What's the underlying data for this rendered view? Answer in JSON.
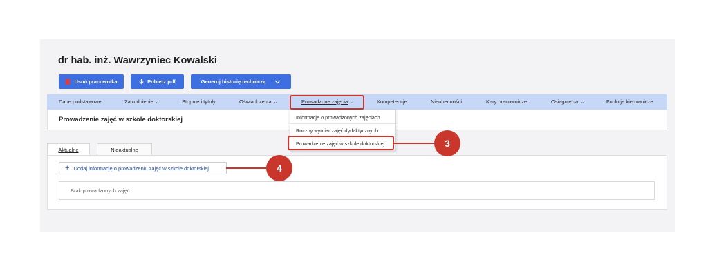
{
  "header": {
    "title": "dr hab. inż. Wawrzyniec Kowalski"
  },
  "toolbar": {
    "delete_label": "Usuń pracownika",
    "download_label": "Pobierz pdf",
    "history_label": "Generuj historię techniczą"
  },
  "nav": {
    "items": [
      {
        "label": "Dane podstawowe",
        "dropdown": false
      },
      {
        "label": "Zatrudnienie",
        "dropdown": true
      },
      {
        "label": "Stopnie i tytuły",
        "dropdown": false
      },
      {
        "label": "Oświadczenia",
        "dropdown": true
      },
      {
        "label": "Prowadzone zajęcia",
        "dropdown": true,
        "active": true
      },
      {
        "label": "Kompetencje",
        "dropdown": false
      },
      {
        "label": "Nieobecności",
        "dropdown": false
      },
      {
        "label": "Kary pracownicze",
        "dropdown": false
      },
      {
        "label": "Osiągnięcia",
        "dropdown": true
      },
      {
        "label": "Funkcje kierownicze",
        "dropdown": false
      }
    ]
  },
  "dropdown": {
    "items": [
      "Informacje o prowadzonych zajęciach",
      "Roczny wymiar zajęć dydaktycznych",
      "Prowadzenie zajęć w szkole doktorskiej"
    ]
  },
  "section": {
    "heading": "Prowadzenie zajęć w szkole doktorskiej"
  },
  "tabs": [
    {
      "label": "Aktualne",
      "active": true
    },
    {
      "label": "Nieaktualne",
      "active": false
    }
  ],
  "content": {
    "add_label": "Dodaj informację o prowadzeniu zajęć w szkole doktorskiej",
    "empty_label": "Brak prowadzonych zajęć"
  },
  "callouts": [
    "3",
    "4"
  ],
  "colors": {
    "accent": "#3d6fe0",
    "navbar": "#c6d7f7",
    "callout": "#c9362b",
    "panel": "#f3f3f6"
  }
}
